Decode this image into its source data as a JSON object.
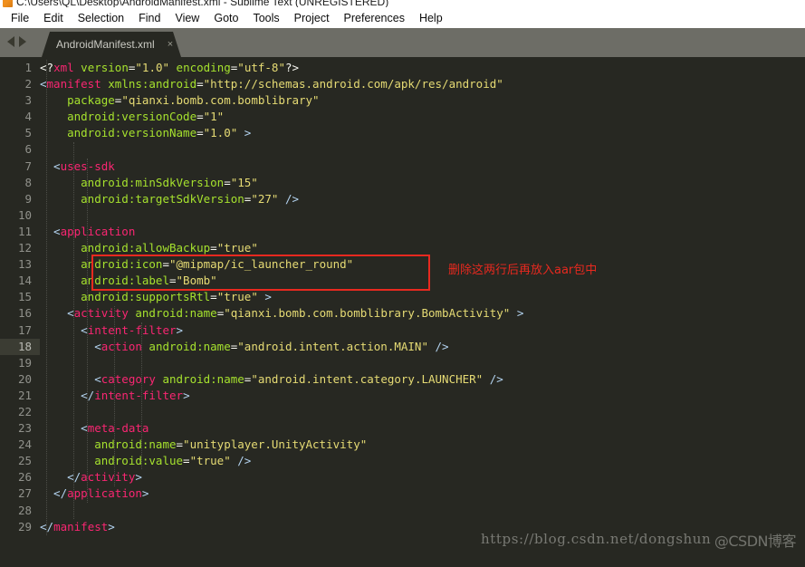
{
  "window": {
    "title": "C:\\Users\\QL\\Desktop\\AndroidManifest.xml - Sublime Text (UNREGISTERED)",
    "icon": "sublime-text-icon"
  },
  "menubar": {
    "items": [
      {
        "label": "File"
      },
      {
        "label": "Edit"
      },
      {
        "label": "Selection"
      },
      {
        "label": "Find"
      },
      {
        "label": "View"
      },
      {
        "label": "Goto"
      },
      {
        "label": "Tools"
      },
      {
        "label": "Project"
      },
      {
        "label": "Preferences"
      },
      {
        "label": "Help"
      }
    ]
  },
  "tabbar": {
    "nav_back": "nav-back-arrow",
    "nav_forward": "nav-forward-arrow",
    "tabs": [
      {
        "label": "AndroidManifest.xml",
        "close": "×",
        "active": true
      }
    ]
  },
  "editor": {
    "active_line": 18,
    "colors": {
      "background": "#272822",
      "tag": "#f92672",
      "attribute": "#a6e22e",
      "string": "#e6db74",
      "punctuation": "#b4d4f1",
      "gutter_text": "#90918b",
      "annotation_red": "#e8291f"
    },
    "lines": [
      {
        "n": 1,
        "tokens": [
          {
            "t": "plainpunct",
            "v": "<?"
          },
          {
            "t": "tag",
            "v": "xml"
          },
          {
            "t": "attr",
            "v": " version"
          },
          {
            "t": "plainpunct",
            "v": "="
          },
          {
            "t": "str",
            "v": "\"1.0\""
          },
          {
            "t": "attr",
            "v": " encoding"
          },
          {
            "t": "plainpunct",
            "v": "="
          },
          {
            "t": "str",
            "v": "\"utf-8\""
          },
          {
            "t": "plainpunct",
            "v": "?>"
          }
        ]
      },
      {
        "n": 2,
        "tokens": [
          {
            "t": "punct",
            "v": "<"
          },
          {
            "t": "tag",
            "v": "manifest"
          },
          {
            "t": "attr",
            "v": " xmlns:android"
          },
          {
            "t": "plainpunct",
            "v": "="
          },
          {
            "t": "str",
            "v": "\"http://schemas.android.com/apk/res/android\""
          }
        ]
      },
      {
        "n": 3,
        "tokens": [
          {
            "t": "attr",
            "v": "    package"
          },
          {
            "t": "plainpunct",
            "v": "="
          },
          {
            "t": "str",
            "v": "\"qianxi.bomb.com.bomblibrary\""
          }
        ]
      },
      {
        "n": 4,
        "tokens": [
          {
            "t": "attr",
            "v": "    android:versionCode"
          },
          {
            "t": "plainpunct",
            "v": "="
          },
          {
            "t": "str",
            "v": "\"1\""
          }
        ]
      },
      {
        "n": 5,
        "tokens": [
          {
            "t": "attr",
            "v": "    android:versionName"
          },
          {
            "t": "plainpunct",
            "v": "="
          },
          {
            "t": "str",
            "v": "\"1.0\""
          },
          {
            "t": "punct",
            "v": " >"
          }
        ]
      },
      {
        "n": 6,
        "tokens": []
      },
      {
        "n": 7,
        "tokens": [
          {
            "t": "punct",
            "v": "  <"
          },
          {
            "t": "tag",
            "v": "uses-sdk"
          }
        ]
      },
      {
        "n": 8,
        "tokens": [
          {
            "t": "attr",
            "v": "      android:minSdkVersion"
          },
          {
            "t": "plainpunct",
            "v": "="
          },
          {
            "t": "str",
            "v": "\"15\""
          }
        ]
      },
      {
        "n": 9,
        "tokens": [
          {
            "t": "attr",
            "v": "      android:targetSdkVersion"
          },
          {
            "t": "plainpunct",
            "v": "="
          },
          {
            "t": "str",
            "v": "\"27\""
          },
          {
            "t": "punct",
            "v": " />"
          }
        ]
      },
      {
        "n": 10,
        "tokens": []
      },
      {
        "n": 11,
        "tokens": [
          {
            "t": "punct",
            "v": "  <"
          },
          {
            "t": "tag",
            "v": "application"
          }
        ]
      },
      {
        "n": 12,
        "tokens": [
          {
            "t": "attr",
            "v": "      android:allowBackup"
          },
          {
            "t": "plainpunct",
            "v": "="
          },
          {
            "t": "str",
            "v": "\"true\""
          }
        ]
      },
      {
        "n": 13,
        "tokens": [
          {
            "t": "attr",
            "v": "      android:icon"
          },
          {
            "t": "plainpunct",
            "v": "="
          },
          {
            "t": "str",
            "v": "\"@mipmap/ic_launcher_round\""
          }
        ]
      },
      {
        "n": 14,
        "tokens": [
          {
            "t": "attr",
            "v": "      android:label"
          },
          {
            "t": "plainpunct",
            "v": "="
          },
          {
            "t": "str",
            "v": "\"Bomb\""
          }
        ]
      },
      {
        "n": 15,
        "tokens": [
          {
            "t": "attr",
            "v": "      android:supportsRtl"
          },
          {
            "t": "plainpunct",
            "v": "="
          },
          {
            "t": "str",
            "v": "\"true\""
          },
          {
            "t": "punct",
            "v": " >"
          }
        ]
      },
      {
        "n": 16,
        "tokens": [
          {
            "t": "punct",
            "v": "    <"
          },
          {
            "t": "tag",
            "v": "activity"
          },
          {
            "t": "attr",
            "v": " android:name"
          },
          {
            "t": "plainpunct",
            "v": "="
          },
          {
            "t": "str",
            "v": "\"qianxi.bomb.com.bomblibrary.BombActivity\""
          },
          {
            "t": "punct",
            "v": " >"
          }
        ]
      },
      {
        "n": 17,
        "tokens": [
          {
            "t": "punct",
            "v": "      <"
          },
          {
            "t": "tag",
            "v": "intent-filter"
          },
          {
            "t": "punct",
            "v": ">"
          }
        ]
      },
      {
        "n": 18,
        "tokens": [
          {
            "t": "punct",
            "v": "        <"
          },
          {
            "t": "tag",
            "v": "action"
          },
          {
            "t": "attr",
            "v": " android:name"
          },
          {
            "t": "plainpunct",
            "v": "="
          },
          {
            "t": "str",
            "v": "\"android.intent.action.MAIN\""
          },
          {
            "t": "punct",
            "v": " />"
          }
        ]
      },
      {
        "n": 19,
        "tokens": []
      },
      {
        "n": 20,
        "tokens": [
          {
            "t": "punct",
            "v": "        <"
          },
          {
            "t": "tag",
            "v": "category"
          },
          {
            "t": "attr",
            "v": " android:name"
          },
          {
            "t": "plainpunct",
            "v": "="
          },
          {
            "t": "str",
            "v": "\"android.intent.category.LAUNCHER\""
          },
          {
            "t": "punct",
            "v": " />"
          }
        ]
      },
      {
        "n": 21,
        "tokens": [
          {
            "t": "punct",
            "v": "      </"
          },
          {
            "t": "tag",
            "v": "intent-filter"
          },
          {
            "t": "punct",
            "v": ">"
          }
        ]
      },
      {
        "n": 22,
        "tokens": []
      },
      {
        "n": 23,
        "tokens": [
          {
            "t": "punct",
            "v": "      <"
          },
          {
            "t": "tag",
            "v": "meta-data"
          }
        ]
      },
      {
        "n": 24,
        "tokens": [
          {
            "t": "attr",
            "v": "        android:name"
          },
          {
            "t": "plainpunct",
            "v": "="
          },
          {
            "t": "str",
            "v": "\"unityplayer.UnityActivity\""
          }
        ]
      },
      {
        "n": 25,
        "tokens": [
          {
            "t": "attr",
            "v": "        android:value"
          },
          {
            "t": "plainpunct",
            "v": "="
          },
          {
            "t": "str",
            "v": "\"true\""
          },
          {
            "t": "punct",
            "v": " />"
          }
        ]
      },
      {
        "n": 26,
        "tokens": [
          {
            "t": "punct",
            "v": "    </"
          },
          {
            "t": "tag",
            "v": "activity"
          },
          {
            "t": "punct",
            "v": ">"
          }
        ]
      },
      {
        "n": 27,
        "tokens": [
          {
            "t": "punct",
            "v": "  </"
          },
          {
            "t": "tag",
            "v": "application"
          },
          {
            "t": "punct",
            "v": ">"
          }
        ]
      },
      {
        "n": 28,
        "tokens": []
      },
      {
        "n": 29,
        "tokens": [
          {
            "t": "punct",
            "v": "</"
          },
          {
            "t": "tag",
            "v": "manifest"
          },
          {
            "t": "punct",
            "v": ">"
          }
        ]
      }
    ]
  },
  "annotation": {
    "text": "删除这两行后再放入aar包中",
    "highlight_lines": [
      13,
      14
    ]
  },
  "watermark": {
    "url": "https://blog.csdn.net/dongshun",
    "logo": "@CSDN博客"
  }
}
